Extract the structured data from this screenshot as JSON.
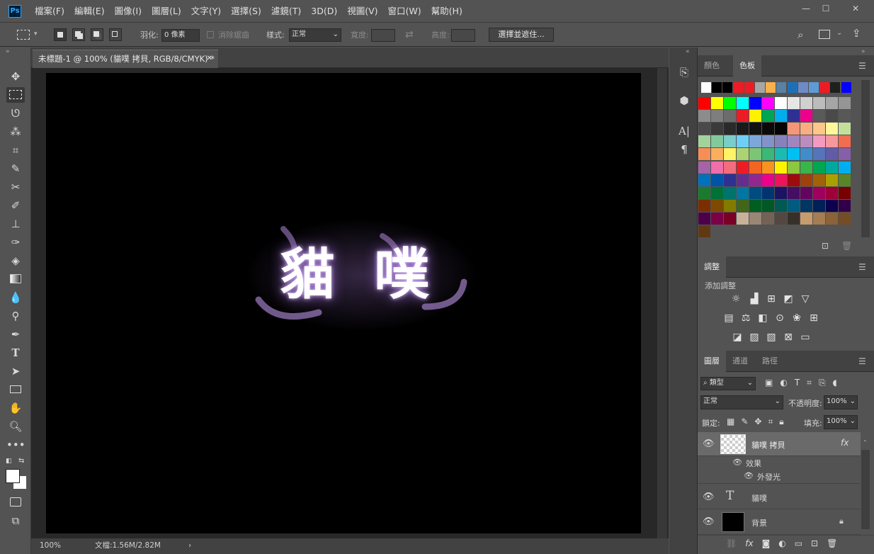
{
  "app": {
    "logo": "Ps",
    "menu": [
      "檔案(F)",
      "編輯(E)",
      "圖像(I)",
      "圖層(L)",
      "文字(Y)",
      "選擇(S)",
      "濾鏡(T)",
      "3D(D)",
      "視圖(V)",
      "窗口(W)",
      "幫助(H)"
    ]
  },
  "window_controls": {
    "minimize": "—",
    "maximize": "☐",
    "close": "✕"
  },
  "options": {
    "feather_label": "羽化:",
    "feather_value": "0 像素",
    "antialias_label": "消除鋸齒",
    "style_label": "樣式:",
    "style_value": "正常",
    "width_label": "寬度:",
    "height_label": "高度:",
    "select_mask": "選擇並遮住..."
  },
  "document": {
    "tab_title": "未標題-1 @ 100% (貓噗 拷貝, RGB/8/CMYK) *",
    "close": "✕",
    "canvas_text": "貓 噗",
    "zoom": "100%",
    "doc_size": "文檔:1.56M/2.82M",
    "status_arrow": "›"
  },
  "swatches_panel": {
    "tabs": [
      "顏色",
      "色板"
    ],
    "active": "色板"
  },
  "adjust_panel": {
    "title": "調整",
    "subtitle": "添加調整",
    "icons": [
      "brightness-icon",
      "levels-icon",
      "curves-icon",
      "exposure-icon",
      "vibrance-icon",
      "hue-sat-icon",
      "color-balance-icon",
      "bw-icon",
      "photo-filter-icon",
      "channel-mixer-icon",
      "color-lookup-icon",
      "invert-icon",
      "posterize-icon",
      "threshold-icon",
      "gradient-map-icon",
      "selective-color-icon"
    ]
  },
  "layers_panel": {
    "tabs": [
      "圖層",
      "通道",
      "路徑"
    ],
    "filter_label": "類型",
    "blend_mode": "正常",
    "opacity_label": "不透明度:",
    "opacity_value": "100%",
    "lock_label": "鎖定:",
    "fill_label": "填充:",
    "fill_value": "100%",
    "layers": [
      {
        "name": "貓噗 拷貝",
        "fx": "fx"
      },
      {
        "name": "效果"
      },
      {
        "name": "外發光"
      },
      {
        "name": "貓噗",
        "type_icon": "T"
      },
      {
        "name": "背景"
      }
    ]
  },
  "colors": {
    "accent": "#31a8ff",
    "bg": "#535353",
    "canvas": "#000000",
    "glow": "#b58fd9"
  },
  "swatch_colors": [
    "#ffffff",
    "#000000",
    "#000000",
    "#ed1c24",
    "#ed1c24",
    "#a6a6a6",
    "#f7b04a",
    "#5a80a4",
    "#1c70b8",
    "#6e8bc6",
    "#5e9bd6",
    "#ed1c24",
    "#1f1f1f",
    "#0000ff",
    "#ff0000",
    "#ffff00",
    "#00ff00",
    "#00ffff",
    "#0000ff",
    "#ff00ff",
    "#ffffff",
    "#e6e6e6",
    "#d0d0d0",
    "#bcbcbc",
    "#a6a6a6",
    "#959595",
    "#8c8c8c",
    "#7e7e7e",
    "#6c6c6c",
    "#ed1c24",
    "#fff200",
    "#00a651",
    "#00aeef",
    "#2e3192",
    "#ec008c",
    "#5a5a5a",
    "#4a4a4a",
    "#585858",
    "#4a4a4a",
    "#3a3a3a",
    "#2a2a2a",
    "#1a1a1a",
    "#111111",
    "#0a0a0a",
    "#050505",
    "#f69679",
    "#f9ad81",
    "#fdc68a",
    "#fff79a",
    "#c4df9b",
    "#a3d39c",
    "#82ca9d",
    "#7bcdc8",
    "#6dcff6",
    "#7da7d9",
    "#8393ca",
    "#8781bd",
    "#a186be",
    "#bd8cbf",
    "#f49ac1",
    "#f5989d",
    "#f26c4f",
    "#f68e56",
    "#fbaf5d",
    "#fff467",
    "#acd372",
    "#7cc576",
    "#3bb878",
    "#1abbb4",
    "#00bff3",
    "#438ccb",
    "#5574b9",
    "#605ca8",
    "#855fa8",
    "#a763a8",
    "#f06ea9",
    "#f26d7d",
    "#ed1c24",
    "#f26522",
    "#f7941d",
    "#fff200",
    "#8dc63f",
    "#39b54a",
    "#00a651",
    "#00a99d",
    "#00aeef",
    "#0072bc",
    "#0054a6",
    "#2e3192",
    "#662d91",
    "#92278f",
    "#ec008c",
    "#ed145b",
    "#9e0b0f",
    "#a0410d",
    "#a36209",
    "#aba000",
    "#598527",
    "#1a7b30",
    "#007236",
    "#00746b",
    "#0076a3",
    "#004b80",
    "#003471",
    "#1b1464",
    "#440e62",
    "#630460",
    "#9e005d",
    "#9e0039",
    "#790000",
    "#7b2e00",
    "#7d4900",
    "#827b00",
    "#406618",
    "#005e20",
    "#005826",
    "#005952",
    "#005b7f",
    "#003663",
    "#002157",
    "#0d004c",
    "#32004b",
    "#4b0049",
    "#7b0046",
    "#7a0026",
    "#c7b299",
    "#998675",
    "#736357",
    "#534741",
    "#37302a",
    "#c69c6d",
    "#a67c52",
    "#8c6239",
    "#754c24",
    "#603913"
  ]
}
